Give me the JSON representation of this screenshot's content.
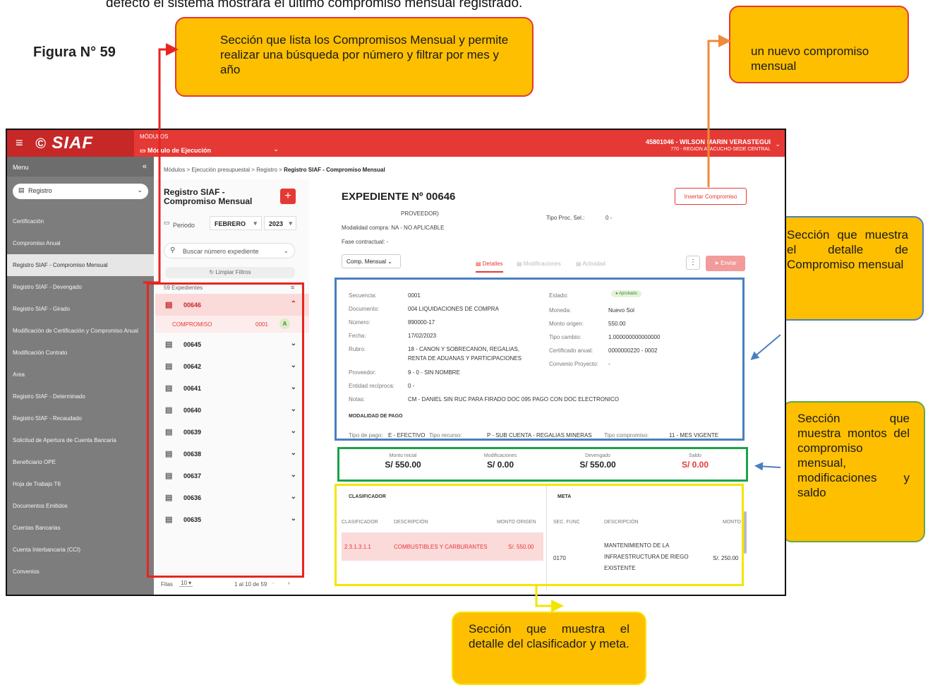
{
  "doc": {
    "top_text": "defecto el sistema mostrará el último compromiso mensual registrado.",
    "figure_label": "Figura N° 59",
    "callouts": {
      "list_section": "Sección que lista los Compromisos Mensual y permite realizar una búsqueda por número y filtrar por mes y año",
      "new_commitment": "un nuevo compromiso mensual",
      "detail_section": "Sección que muestra el detalle de Compromiso mensual",
      "amounts_section": "Sección que muestra montos del compromiso mensual, modificaciones y saldo",
      "classifier_section": "Sección que muestra el detalle del clasificador y meta."
    }
  },
  "app": {
    "brand": "SIAF",
    "module_label": "MÓDULOS",
    "module_value": "Módulo de Ejecución",
    "user_line1": "45801046 - WILSON MARIN VERASTEGUI",
    "user_line2": "770 - REGION AYACUCHO-SEDE CENTRAL",
    "menu_title": "Menu",
    "menu_select": "Registro",
    "menu_items": [
      "Certificación",
      "Compromiso Anual",
      "Registro SIAF - Compromiso Mensual",
      "Registro SIAF - Devengado",
      "Registro SIAF - Girado",
      "Modificación de Certificación y Compromiso Anual",
      "Modificación Contrato",
      "Area",
      "Registro SIAF - Determinado",
      "Registro SIAF - Recaudado",
      "Solicitud de Apertura de Cuenta Bancaria",
      "Beneficiario OPE",
      "Hoja de Trabajo T6",
      "Documentos Emitidos",
      "Cuentas Bancarias",
      "Cuenta Interbancaria (CCI)",
      "Convenios"
    ],
    "breadcrumb": {
      "path": "Módulos > Ejecución presupuestal > Registro > ",
      "current": "Registro SIAF - Compromiso Mensual"
    }
  },
  "list": {
    "title": "Registro SIAF - Compromiso Mensual",
    "period_label": "Periodo",
    "month": "FEBRERO",
    "year": "2023",
    "search_placeholder": "Buscar número expediente",
    "clear_filters": "Limpiar Filtros",
    "count": "59 Expedientes",
    "rows": [
      "00646",
      "00645",
      "00642",
      "00641",
      "00640",
      "00639",
      "00638",
      "00637",
      "00636",
      "00635"
    ],
    "compromiso_label": "COMPROMISO",
    "compromiso_seq": "0001",
    "compromiso_badge": "A",
    "rows_label": "Filas",
    "rows_per_page": "10",
    "page_range": "1 al 10 de 59"
  },
  "detail": {
    "title": "EXPEDIENTE Nº 00646",
    "insert_button": "Insertar Compromiso",
    "proveedor_tail": "PROVEEDOR)",
    "modalidad": "Modalidad compra:  NA - NO APLICABLE",
    "fase": "Fase contractual:   -",
    "tipo_proc": "Tipo Proc. Sel.:",
    "tipo_proc_val": "0 -",
    "comp_select": "Comp. Mensual",
    "tabs": [
      "Detalles",
      "Modificaciones",
      "Actividad"
    ],
    "send_button": "Enviar",
    "fields_left": [
      {
        "k": "Secuencia:",
        "v": "0001"
      },
      {
        "k": "Documento:",
        "v": "004 LIQUIDACIONES DE COMPRA"
      },
      {
        "k": "Número:",
        "v": "890000-17"
      },
      {
        "k": "Fecha:",
        "v": "17/02/2023"
      },
      {
        "k": "Rubro:",
        "v": "18 - CANON Y SOBRECANON, REGALIAS,"
      },
      {
        "k": "",
        "v": "RENTA DE ADUANAS Y PARTICIPACIONES"
      },
      {
        "k": "Proveedor:",
        "v": "9 - 0 - SIN NOMBRE"
      },
      {
        "k": "Entidad recíproca:",
        "v": "0 -"
      },
      {
        "k": "Notas:",
        "v": "CM - DANIEL SIN RUC PARA FIRADO DOC 095 PAGO CON DOC ELECTRONICO"
      }
    ],
    "fields_right": [
      {
        "k": "Estado:",
        "v": "● Aprobado"
      },
      {
        "k": "Moneda:",
        "v": "Nuevo Sol"
      },
      {
        "k": "Monto origen:",
        "v": "550.00"
      },
      {
        "k": "Tipo cambio:",
        "v": "1.000000000000000"
      },
      {
        "k": "Certificado anual:",
        "v": "0000000220 - 0002"
      },
      {
        "k": "Convenio Proyecto:",
        "v": "-"
      }
    ],
    "modalidad_pago": "MODALIDAD DE PAGO",
    "tipo_pago": "Tipo de pago:",
    "tipo_pago_v": "E - EFECTIVO",
    "tipo_recurso": "Tipo recurso:",
    "tipo_recurso_v": "P - SUB CUENTA - REGALIAS MINERAS",
    "tipo_comp": "Tipo compromiso:",
    "tipo_comp_v": "11 - MES VIGENTE",
    "summary": [
      {
        "label": "Monto inicial",
        "value": "S/ 550.00"
      },
      {
        "label": "Modificaciones",
        "value": "S/ 0.00"
      },
      {
        "label": "Devengado",
        "value": "S/ 550.00"
      },
      {
        "label": "Saldo",
        "value": "S/ 0.00"
      }
    ],
    "clasificador": {
      "title": "CLASIFICADOR",
      "h1": "CLASIFICADOR",
      "h2": "DESCRIPCIÓN",
      "h3": "MONTO ORIGEN",
      "c1": "2.3.1.3.1.1",
      "c2": "COMBUSTIBLES Y CARBURANTES",
      "c3": "S/. 550.00"
    },
    "meta": {
      "title": "META",
      "h1": "SEC. FUNC",
      "h2": "DESCRIPCIÓN",
      "h3": "MONTO",
      "c1": "0170",
      "c2a": "MANTENIMIENTO DE LA",
      "c2b": "INFRAESTRUCTURA DE RIEGO",
      "c2c": "EXISTENTE",
      "c3": "S/. 250.00"
    }
  }
}
